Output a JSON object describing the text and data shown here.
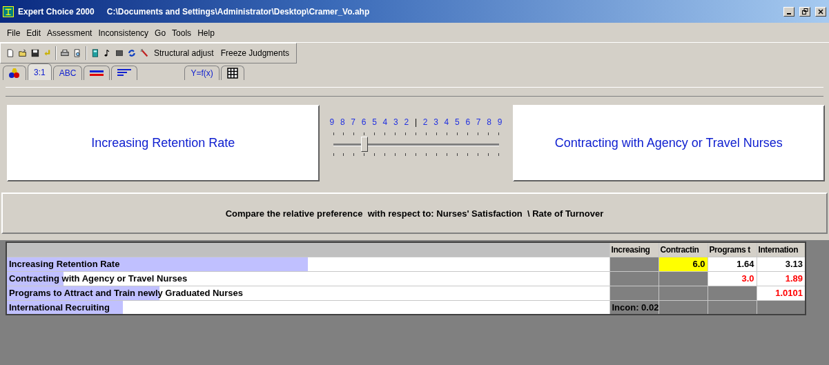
{
  "window": {
    "app": "Expert Choice 2000",
    "path": "C:\\Documents and Settings\\Administrator\\Desktop\\Cramer_Vo.ahp"
  },
  "menu": [
    "File",
    "Edit",
    "Assessment",
    "Inconsistency",
    "Go",
    "Tools",
    "Help"
  ],
  "toolbar": {
    "buttons": [
      "Structural adjust",
      "Freeze Judgments"
    ]
  },
  "tabs": [
    {
      "kind": "icon",
      "selected": false
    },
    {
      "kind": "text",
      "label": "3:1",
      "selected": true
    },
    {
      "kind": "text",
      "label": "ABC",
      "selected": false
    },
    {
      "kind": "icon",
      "selected": false
    },
    {
      "kind": "icon",
      "selected": false
    },
    {
      "kind": "text",
      "label": "Y=f(x)",
      "selected": false
    },
    {
      "kind": "icon",
      "selected": false
    }
  ],
  "comparison": {
    "left": "Increasing Retention Rate",
    "right": "Contracting with Agency or Travel Nurses",
    "scale": [
      "9",
      "8",
      "7",
      "6",
      "5",
      "4",
      "3",
      "2",
      "|",
      "2",
      "3",
      "4",
      "5",
      "6",
      "7",
      "8",
      "9"
    ],
    "level": 0.1875,
    "prompt": "Compare the relative preference  with respect to: Nurses' Satisfaction  \\ Rate of Turnover"
  },
  "matrix": {
    "columns": [
      "Increasing",
      "Contractin",
      "Programs t",
      "Internation"
    ],
    "rows": [
      {
        "name": "Increasing Retention Rate",
        "level": 0.5,
        "cells": [
          {
            "kind": "blank"
          },
          {
            "kind": "value",
            "text": "6.0",
            "inverse": false,
            "selected": true
          },
          {
            "kind": "value",
            "text": "1.64",
            "inverse": false,
            "selected": false
          },
          {
            "kind": "value",
            "text": "3.13",
            "inverse": false,
            "selected": false
          }
        ]
      },
      {
        "name": "Contracting with Agency or Travel Nurses",
        "level": 0.094,
        "cells": [
          {
            "kind": "blank"
          },
          {
            "kind": "blank"
          },
          {
            "kind": "value",
            "text": "3.0",
            "inverse": true,
            "selected": false
          },
          {
            "kind": "value",
            "text": "1.89",
            "inverse": true,
            "selected": false
          }
        ]
      },
      {
        "name": "Programs to Attract and Train newly Graduated Nurses",
        "level": 0.253,
        "cells": [
          {
            "kind": "blank"
          },
          {
            "kind": "blank"
          },
          {
            "kind": "blank"
          },
          {
            "kind": "value",
            "text": "1.0101",
            "inverse": true,
            "selected": false
          }
        ]
      },
      {
        "name": "International Recruiting",
        "level": 0.193,
        "cells": [
          {
            "kind": "note",
            "text": "Incon: 0.02"
          },
          {
            "kind": "blank"
          },
          {
            "kind": "blank"
          },
          {
            "kind": "blank"
          }
        ]
      }
    ]
  }
}
